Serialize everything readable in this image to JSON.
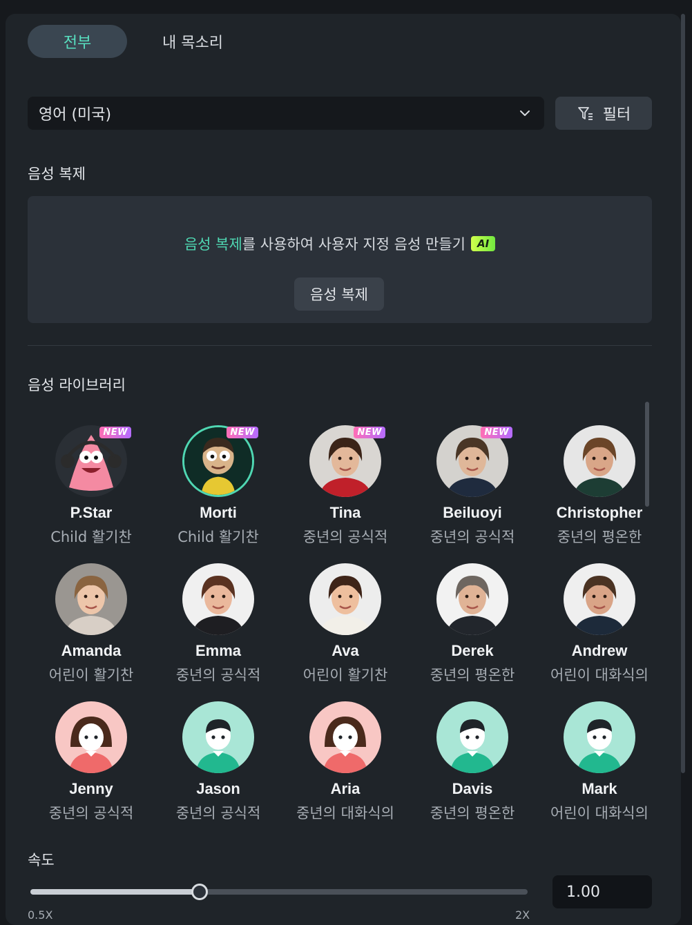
{
  "tabs": {
    "all": "전부",
    "my_voice": "내 목소리"
  },
  "language_select": {
    "value": "영어 (미국)",
    "icon": "chevron-down-icon"
  },
  "filter": {
    "label": "필터",
    "icon": "filter-icon"
  },
  "voice_clone": {
    "section_title": "음성 복제",
    "promo_link": "음성 복제",
    "promo_text": "를 사용하여 사용자 지정 음성 만들기",
    "ai_badge": "AI",
    "button_label": "음성 복제"
  },
  "voice_library": {
    "section_title": "음성 라이브러리",
    "new_badge": "NEW",
    "voices": [
      {
        "name": "P.Star",
        "desc": "Child 활기찬",
        "is_new": true,
        "selected": false,
        "avatar": "starfish-character-avatar"
      },
      {
        "name": "Morti",
        "desc": "Child 활기찬",
        "is_new": true,
        "selected": true,
        "avatar": "cartoon-boy-avatar"
      },
      {
        "name": "Tina",
        "desc": "중년의 공식적",
        "is_new": true,
        "selected": false,
        "avatar": "woman-photo-avatar"
      },
      {
        "name": "Beiluoyi",
        "desc": "중년의 공식적",
        "is_new": true,
        "selected": false,
        "avatar": "man-suit-photo-avatar"
      },
      {
        "name": "Christopher",
        "desc": "중년의 평온한",
        "is_new": false,
        "selected": false,
        "avatar": "bearded-man-photo-avatar"
      },
      {
        "name": "Amanda",
        "desc": "어린이 활기찬",
        "is_new": false,
        "selected": false,
        "avatar": "young-woman-photo-avatar"
      },
      {
        "name": "Emma",
        "desc": "중년의 공식적",
        "is_new": false,
        "selected": false,
        "avatar": "woman-blazer-photo-avatar"
      },
      {
        "name": "Ava",
        "desc": "어린이 활기찬",
        "is_new": false,
        "selected": false,
        "avatar": "woman-brunette-photo-avatar"
      },
      {
        "name": "Derek",
        "desc": "중년의 평온한",
        "is_new": false,
        "selected": false,
        "avatar": "older-man-photo-avatar"
      },
      {
        "name": "Andrew",
        "desc": "어린이 대화식의",
        "is_new": false,
        "selected": false,
        "avatar": "man-headset-photo-avatar"
      },
      {
        "name": "Jenny",
        "desc": "중년의 공식적",
        "is_new": false,
        "selected": false,
        "avatar": "female-placeholder-avatar"
      },
      {
        "name": "Jason",
        "desc": "중년의 공식적",
        "is_new": false,
        "selected": false,
        "avatar": "male-placeholder-avatar"
      },
      {
        "name": "Aria",
        "desc": "중년의 대화식의",
        "is_new": false,
        "selected": false,
        "avatar": "female-placeholder-avatar"
      },
      {
        "name": "Davis",
        "desc": "중년의 평온한",
        "is_new": false,
        "selected": false,
        "avatar": "male-placeholder-avatar"
      },
      {
        "name": "Mark",
        "desc": "어린이 대화식의",
        "is_new": false,
        "selected": false,
        "avatar": "male-placeholder-avatar"
      }
    ]
  },
  "speed": {
    "label": "속도",
    "value": "1.00",
    "fraction": 0.34,
    "min_label": "0.5X",
    "max_label": "2X"
  },
  "colors": {
    "accent": "#4fd7b2",
    "panel_bg": "#1f2429",
    "new_badge": "#ff6fb5"
  }
}
